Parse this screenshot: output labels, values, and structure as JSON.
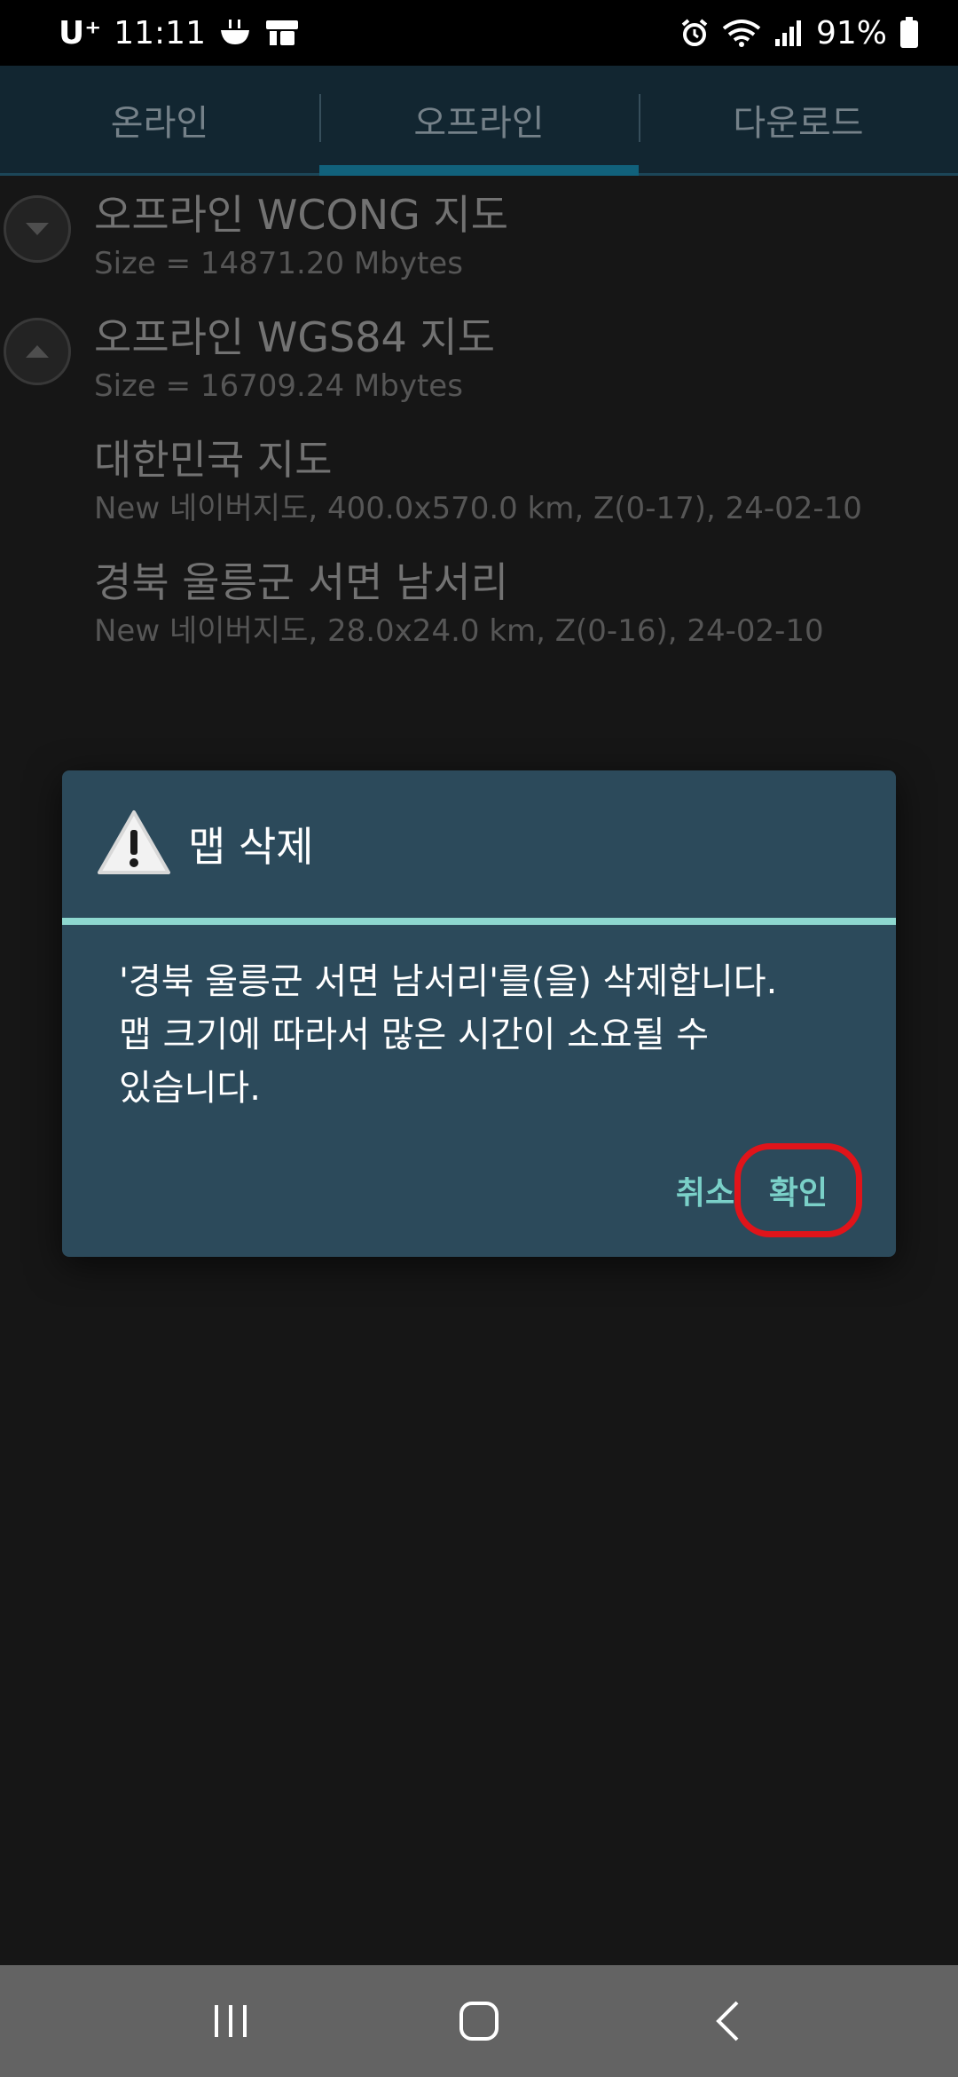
{
  "status_bar": {
    "carrier": "U⁺",
    "time": "11:11",
    "battery": "91%"
  },
  "tabs": [
    {
      "label": "온라인",
      "active": false
    },
    {
      "label": "오프라인",
      "active": true
    },
    {
      "label": "다운로드",
      "active": false
    }
  ],
  "list": [
    {
      "title": "오프라인 WCONG 지도",
      "subtitle": "Size = 14871.20 Mbytes",
      "expander": "chevron-down-icon"
    },
    {
      "title": "오프라인 WGS84 지도",
      "subtitle": "Size = 16709.24 Mbytes",
      "expander": "chevron-up-icon"
    },
    {
      "title": "대한민국 지도",
      "subtitle": "New 네이버지도, 400.0x570.0 km, Z(0-17), 24-02-10"
    },
    {
      "title": "경북 울릉군 서면 남서리",
      "subtitle": "New 네이버지도, 28.0x24.0 km, Z(0-16), 24-02-10"
    }
  ],
  "dialog": {
    "title": "맵 삭제",
    "message_line1": "'경북 울릉군 서면 남서리'를(을) 삭제합니다.",
    "message_line2": "맵 크기에 따라서 많은 시간이 소요될 수",
    "message_line3": "있습니다.",
    "cancel_label": "취소",
    "ok_label": "확인",
    "accent_color": "#8ed8d0",
    "highlight_color": "#e0141a"
  }
}
